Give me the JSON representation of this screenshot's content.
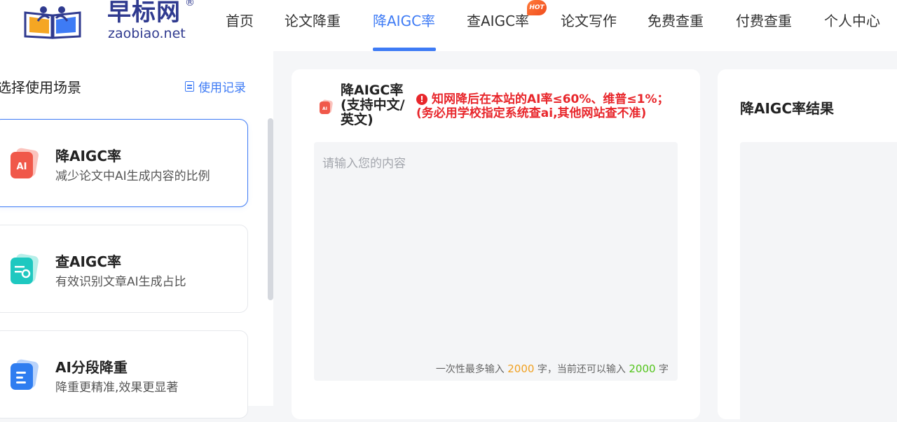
{
  "brand": {
    "name_cn": "早标网",
    "reg_mark": "®",
    "domain": "zaobiao.net",
    "logo_icon": "book-readers-logo-icon",
    "color": "#2f3a8f"
  },
  "nav": {
    "items": [
      {
        "label": "首页"
      },
      {
        "label": "论文降重"
      },
      {
        "label": "降AIGC率",
        "active": true
      },
      {
        "label": "查AIGC率",
        "badge": "HOT"
      },
      {
        "label": "论文写作"
      },
      {
        "label": "免费查重"
      },
      {
        "label": "付费查重"
      },
      {
        "label": "个人中心"
      }
    ],
    "active_color": "#3e7bf5"
  },
  "sidebar": {
    "title": "选择使用场景",
    "history_label": "使用记录",
    "history_icon": "document-list-icon",
    "scenarios": [
      {
        "name": "降AIGC率",
        "desc": "减少论文中AI生成内容的比例",
        "icon": "ai-reduce-icon",
        "color": "#f0584a",
        "active": true
      },
      {
        "name": "查AIGC率",
        "desc": "有效识别文章AI生成占比",
        "icon": "ai-check-icon",
        "color": "#1ec8c0"
      },
      {
        "name": "AI分段降重",
        "desc": "降重更精准,效果更显著",
        "icon": "ai-segment-icon",
        "color": "#2f7df0"
      }
    ]
  },
  "main": {
    "title": "降AIGC率(支持中文/英文)",
    "title_icon": "ai-reduce-icon",
    "warning_icon": "exclamation-circle-icon",
    "warning": "知网降后在本站的AI率≤60%、维普≤1%；(务必用学校指定系统查ai,其他网站查不准)",
    "input_placeholder": "请输入您的内容",
    "input_value": "",
    "counter_prefix": "一次性最多输入",
    "max_chars": "2000",
    "counter_mid": "字，当前还可以输入",
    "remaining_chars": "2000",
    "counter_suffix": "字"
  },
  "result": {
    "title": "降AIGC率结果"
  }
}
